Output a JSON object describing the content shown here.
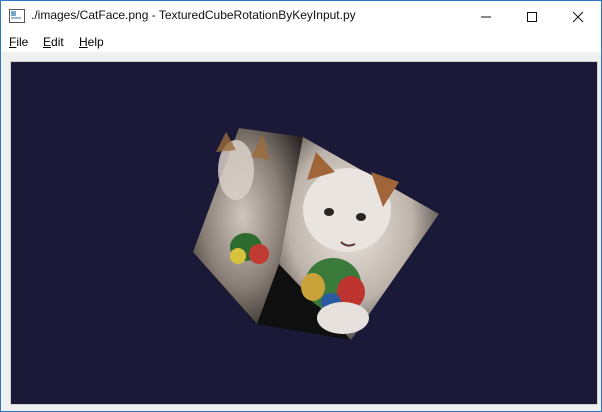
{
  "window": {
    "title": "./images/CatFace.png - TexturedCubeRotationByKeyInput.py",
    "icon": "app-window-icon",
    "controls": {
      "minimize": "minimize-icon",
      "maximize": "maximize-icon",
      "close": "close-icon"
    }
  },
  "menu": {
    "file": "File",
    "edit": "Edit",
    "help": "Help"
  },
  "viewport": {
    "background": "#1a1a38",
    "content": "textured-cube-catface"
  }
}
